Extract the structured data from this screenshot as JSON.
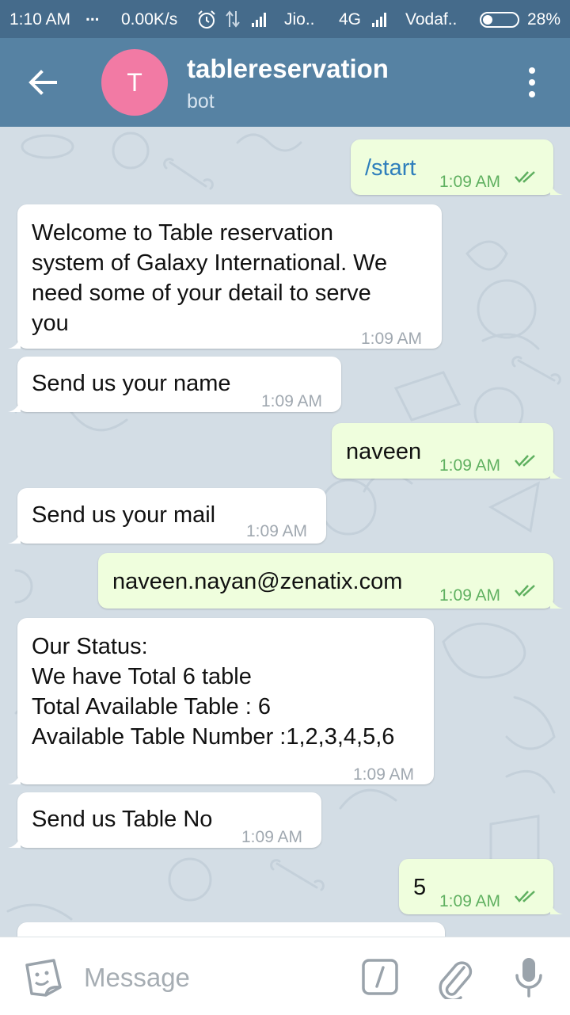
{
  "status_bar": {
    "time": "1:10 AM",
    "dots": "...",
    "speed": "0.00K/s",
    "carrier1": "Jio..",
    "network": "4G",
    "carrier2": "Vodaf..",
    "battery": "28%",
    "battery_level": 0.28
  },
  "header": {
    "avatar_letter": "T",
    "title": "tablereservation",
    "subtitle": "bot",
    "avatar_color": "#f27aa4",
    "header_color": "#5682a3"
  },
  "messages": [
    {
      "direction": "out",
      "text": "/start",
      "time": "1:09 AM"
    },
    {
      "direction": "in",
      "text": "Welcome to Table reservation\nsystem of Galaxy International. We\nneed some of your detail to serve\nyou",
      "time": "1:09 AM"
    },
    {
      "direction": "in",
      "text": "Send us your name",
      "time": "1:09 AM"
    },
    {
      "direction": "out",
      "text": "naveen",
      "time": "1:09 AM"
    },
    {
      "direction": "in",
      "text": "Send us your mail",
      "time": "1:09 AM"
    },
    {
      "direction": "out",
      "text": "naveen.nayan@zenatix.com",
      "time": "1:09 AM"
    },
    {
      "direction": "in",
      "text": "Our Status:\nWe have Total 6 table\nTotal Available Table : 6\nAvailable Table Number :1,2,3,4,5,6",
      "time": "1:09 AM"
    },
    {
      "direction": "in",
      "text": "Send us Table No",
      "time": "1:09 AM"
    },
    {
      "direction": "out",
      "text": "5",
      "time": "1:09 AM"
    }
  ],
  "input": {
    "placeholder": "Message"
  },
  "icons": {
    "back": "arrow-left-icon",
    "more": "more-vertical-icon",
    "sticker": "sticker-icon",
    "command": "bot-command-icon",
    "attach": "paperclip-icon",
    "mic": "microphone-icon"
  },
  "colors": {
    "outgoing_bubble": "#effedd",
    "incoming_bubble": "#ffffff",
    "read_check": "#5fb060",
    "chat_background": "#d3dde5"
  }
}
